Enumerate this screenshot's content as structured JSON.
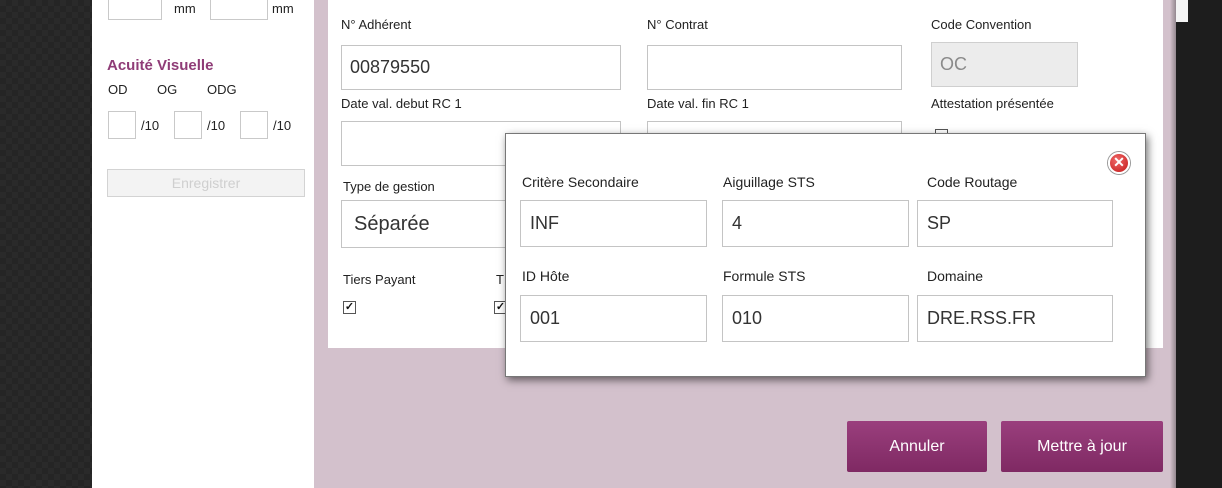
{
  "left_panel": {
    "top_units": [
      "mm",
      "mm"
    ],
    "acuite_title": "Acuité Visuelle",
    "acuite_cols": [
      "OD",
      "OG",
      "ODG"
    ],
    "acuite_units": [
      "/10",
      "/10",
      "/10"
    ],
    "save_label": "Enregistrer"
  },
  "form": {
    "adherent_label": "N° Adhérent",
    "adherent_value": "00879550",
    "contrat_label": "N° Contrat",
    "contrat_value": "",
    "convention_label": "Code Convention",
    "convention_value": "OC",
    "date_debut_label": "Date val. debut RC 1",
    "date_fin_label": "Date val. fin RC 1",
    "attestation_label": "Attestation présentée",
    "type_gestion_label": "Type de gestion",
    "type_gestion_value": "Séparée",
    "tiers_payant_label": "Tiers Payant",
    "tiers_payant_checked": true,
    "second_check_label_prefix": "T"
  },
  "popup": {
    "critere_label": "Critère Secondaire",
    "critere_value": "INF",
    "aiguillage_label": "Aiguillage STS",
    "aiguillage_value": "4",
    "routage_label": "Code Routage",
    "routage_value": "SP",
    "id_hote_label": "ID Hôte",
    "id_hote_value": "001",
    "formule_label": "Formule STS",
    "formule_value": "010",
    "domaine_label": "Domaine",
    "domaine_value": "DRE.RSS.FR",
    "close_icon": "close-icon"
  },
  "actions": {
    "cancel_label": "Annuler",
    "update_label": "Mettre à jour"
  },
  "colors": {
    "accent": "#8f3c77",
    "button": "#8a3170",
    "background_area": "#d3c1cc"
  }
}
